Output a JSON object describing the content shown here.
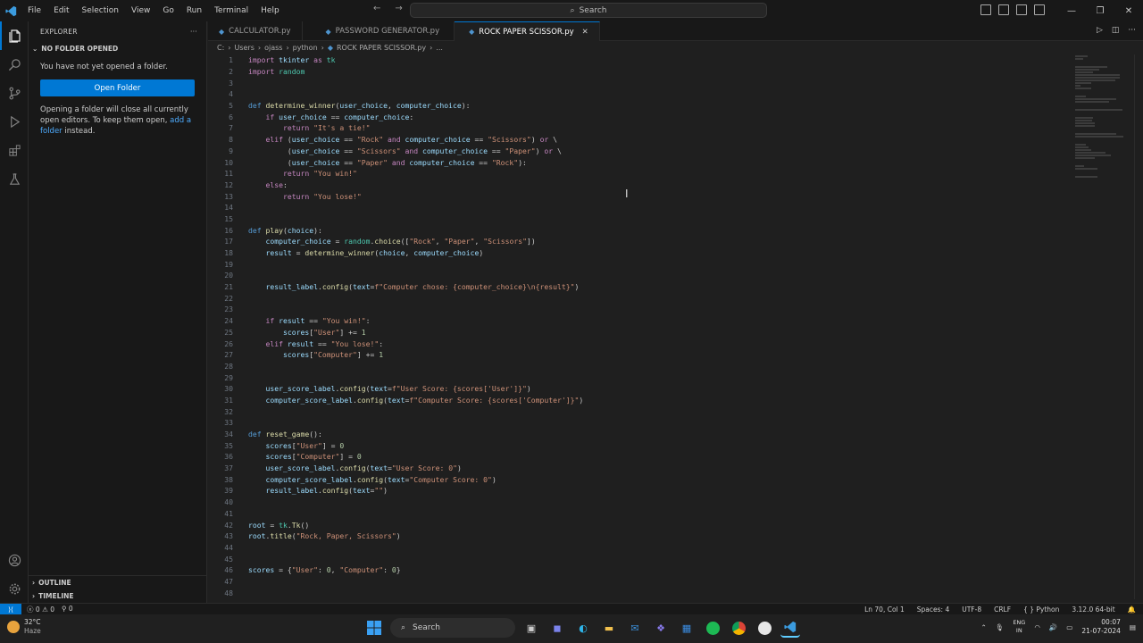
{
  "menu": [
    "File",
    "Edit",
    "Selection",
    "View",
    "Go",
    "Run",
    "Terminal",
    "Help"
  ],
  "search": {
    "label": "Search"
  },
  "sidebar": {
    "title": "EXPLORER",
    "section": "NO FOLDER OPENED",
    "message": "You have not yet opened a folder.",
    "open_folder": "Open Folder",
    "hint_prefix": "Opening a folder will close all currently open editors. To keep them open, ",
    "hint_link": "add a folder",
    "hint_suffix": " instead.",
    "outline": "OUTLINE",
    "timeline": "TIMELINE"
  },
  "tabs": [
    {
      "label": "CALCULATOR.py"
    },
    {
      "label": "PASSWORD GENERATOR.py"
    },
    {
      "label": "ROCK PAPER SCISSOR.py"
    }
  ],
  "breadcrumb": [
    "C:",
    "Users",
    "ojass",
    "python",
    "ROCK PAPER SCISSOR.py",
    "..."
  ],
  "code": [
    {
      "n": "1",
      "t": "import tkinter as tk"
    },
    {
      "n": "2",
      "t": "import random"
    },
    {
      "n": "3",
      "t": ""
    },
    {
      "n": "4",
      "t": ""
    },
    {
      "n": "5",
      "t": "def determine_winner(user_choice, computer_choice):"
    },
    {
      "n": "6",
      "t": "    if user_choice == computer_choice:"
    },
    {
      "n": "7",
      "t": "        return \"It's a tie!\""
    },
    {
      "n": "8",
      "t": "    elif (user_choice == \"Rock\" and computer_choice == \"Scissors\") or \\"
    },
    {
      "n": "9",
      "t": "         (user_choice == \"Scissors\" and computer_choice == \"Paper\") or \\"
    },
    {
      "n": "10",
      "t": "         (user_choice == \"Paper\" and computer_choice == \"Rock\"):"
    },
    {
      "n": "11",
      "t": "        return \"You win!\""
    },
    {
      "n": "12",
      "t": "    else:"
    },
    {
      "n": "13",
      "t": "        return \"You lose!\""
    },
    {
      "n": "14",
      "t": ""
    },
    {
      "n": "15",
      "t": ""
    },
    {
      "n": "16",
      "t": "def play(choice):"
    },
    {
      "n": "17",
      "t": "    computer_choice = random.choice([\"Rock\", \"Paper\", \"Scissors\"])"
    },
    {
      "n": "18",
      "t": "    result = determine_winner(choice, computer_choice)"
    },
    {
      "n": "19",
      "t": ""
    },
    {
      "n": "20",
      "t": ""
    },
    {
      "n": "21",
      "t": "    result_label.config(text=f\"Computer chose: {computer_choice}\\n{result}\")"
    },
    {
      "n": "22",
      "t": ""
    },
    {
      "n": "23",
      "t": ""
    },
    {
      "n": "24",
      "t": "    if result == \"You win!\":"
    },
    {
      "n": "25",
      "t": "        scores[\"User\"] += 1"
    },
    {
      "n": "26",
      "t": "    elif result == \"You lose!\":"
    },
    {
      "n": "27",
      "t": "        scores[\"Computer\"] += 1"
    },
    {
      "n": "28",
      "t": ""
    },
    {
      "n": "29",
      "t": ""
    },
    {
      "n": "30",
      "t": "    user_score_label.config(text=f\"User Score: {scores['User']}\")"
    },
    {
      "n": "31",
      "t": "    computer_score_label.config(text=f\"Computer Score: {scores['Computer']}\")"
    },
    {
      "n": "32",
      "t": ""
    },
    {
      "n": "33",
      "t": ""
    },
    {
      "n": "34",
      "t": "def reset_game():"
    },
    {
      "n": "35",
      "t": "    scores[\"User\"] = 0"
    },
    {
      "n": "36",
      "t": "    scores[\"Computer\"] = 0"
    },
    {
      "n": "37",
      "t": "    user_score_label.config(text=\"User Score: 0\")"
    },
    {
      "n": "38",
      "t": "    computer_score_label.config(text=\"Computer Score: 0\")"
    },
    {
      "n": "39",
      "t": "    result_label.config(text=\"\")"
    },
    {
      "n": "40",
      "t": ""
    },
    {
      "n": "41",
      "t": ""
    },
    {
      "n": "42",
      "t": "root = tk.Tk()"
    },
    {
      "n": "43",
      "t": "root.title(\"Rock, Paper, Scissors\")"
    },
    {
      "n": "44",
      "t": ""
    },
    {
      "n": "45",
      "t": ""
    },
    {
      "n": "46",
      "t": "scores = {\"User\": 0, \"Computer\": 0}"
    },
    {
      "n": "47",
      "t": ""
    },
    {
      "n": "48",
      "t": ""
    }
  ],
  "status": {
    "errors": "0",
    "warnings": "0",
    "ports": "0",
    "position": "Ln 70, Col 1",
    "spaces": "Spaces: 4",
    "encoding": "UTF-8",
    "eol": "CRLF",
    "language": "Python",
    "interpreter": "3.12.0 64-bit"
  },
  "taskbar": {
    "temp": "32°C",
    "weather": "Haze",
    "search": "Search",
    "lang_top": "ENG",
    "lang_bottom": "IN",
    "time": "00:07",
    "date": "21-07-2024"
  },
  "colors": {
    "keyword": "#c586c0",
    "def": "#569cd6",
    "function": "#dcdcaa",
    "string": "#ce9178",
    "variable": "#9cdcfe",
    "number": "#b5cea8",
    "accent": "#0078d4"
  }
}
